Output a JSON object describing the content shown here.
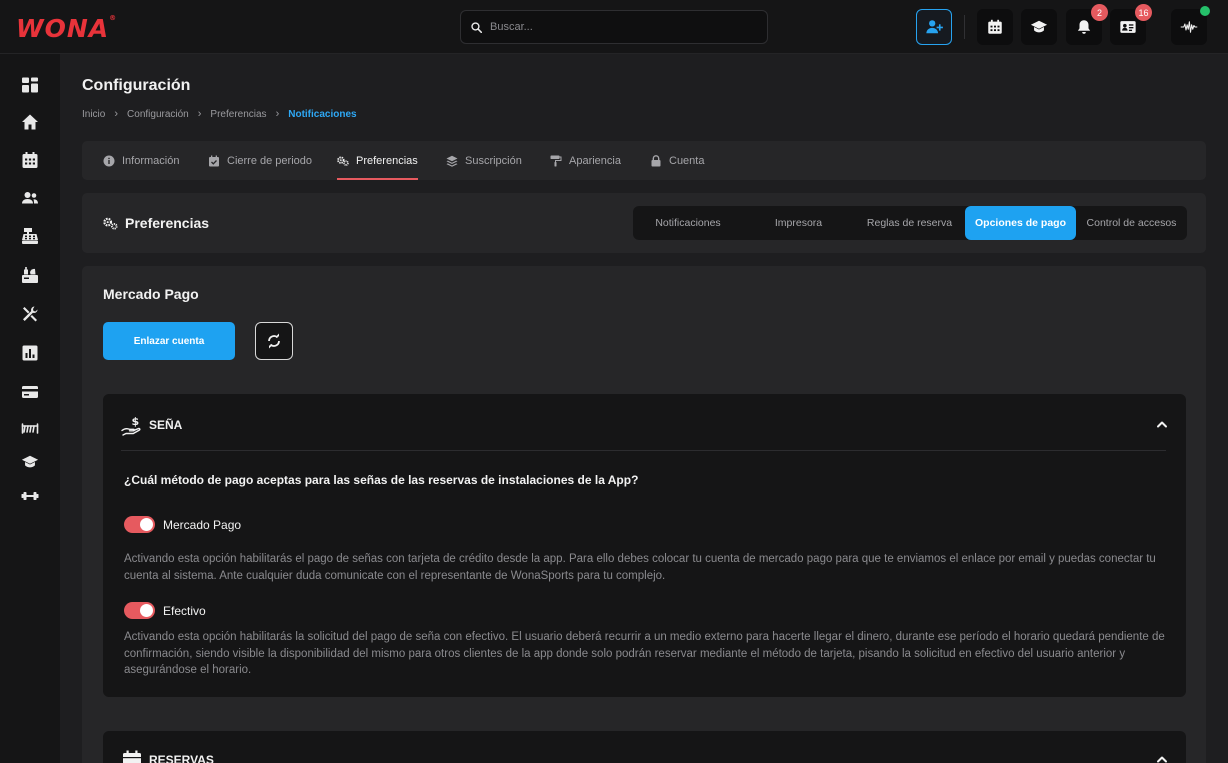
{
  "app": {
    "logo": "WONA",
    "logo_mark": "®"
  },
  "search": {
    "placeholder": "Buscar..."
  },
  "header_actions": {
    "notifications_badge": "2",
    "contacts_badge": "16"
  },
  "page": {
    "title": "Configuración"
  },
  "breadcrumb": [
    "Inicio",
    "Configuración",
    "Preferencias",
    "Notificaciones"
  ],
  "tabs": [
    {
      "label": "Información",
      "icon": "info-icon"
    },
    {
      "label": "Cierre de periodo",
      "icon": "calendar-check-icon"
    },
    {
      "label": "Preferencias",
      "icon": "gears-icon"
    },
    {
      "label": "Suscripción",
      "icon": "layers-icon"
    },
    {
      "label": "Apariencia",
      "icon": "paint-roller-icon"
    },
    {
      "label": "Cuenta",
      "icon": "lock-icon"
    }
  ],
  "preferences": {
    "title": "Preferencias",
    "segments": [
      "Notificaciones",
      "Impresora",
      "Reglas de reserva",
      "Opciones de pago",
      "Control de accesos"
    ]
  },
  "mercado_pago": {
    "title": "Mercado Pago",
    "link_button": "Enlazar cuenta"
  },
  "sena": {
    "title": "SEÑA",
    "question": "¿Cuál método de pago aceptas para las señas de las reservas de instalaciones de la App?",
    "option1_label": "Mercado Pago",
    "option1_desc": "Activando esta opción habilitarás el pago de señas con tarjeta de crédito desde la app. Para ello debes colocar tu cuenta de mercado pago para que te enviamos el enlace por email y puedas conectar tu cuenta al sistema. Ante cualquier duda comunicate con el representante de WonaSports para tu complejo.",
    "option2_label": "Efectivo",
    "option2_desc": "Activando esta opción habilitarás la solicitud del pago de seña con efectivo. El usuario deberá recurrir a un medio externo para hacerte llegar el dinero, durante ese período el horario quedará pendiente de confirmación, siendo visible la disponibilidad del mismo para otros clientes de la app donde solo podrán reservar mediante el método de tarjeta, pisando la solicitud en efectivo del usuario anterior y asegurándose el horario."
  },
  "reservas": {
    "title": "RESERVAS"
  },
  "colors": {
    "accent": "#1ea2f1",
    "brand": "#e8333a",
    "toggle_on": "#e65a5f"
  }
}
